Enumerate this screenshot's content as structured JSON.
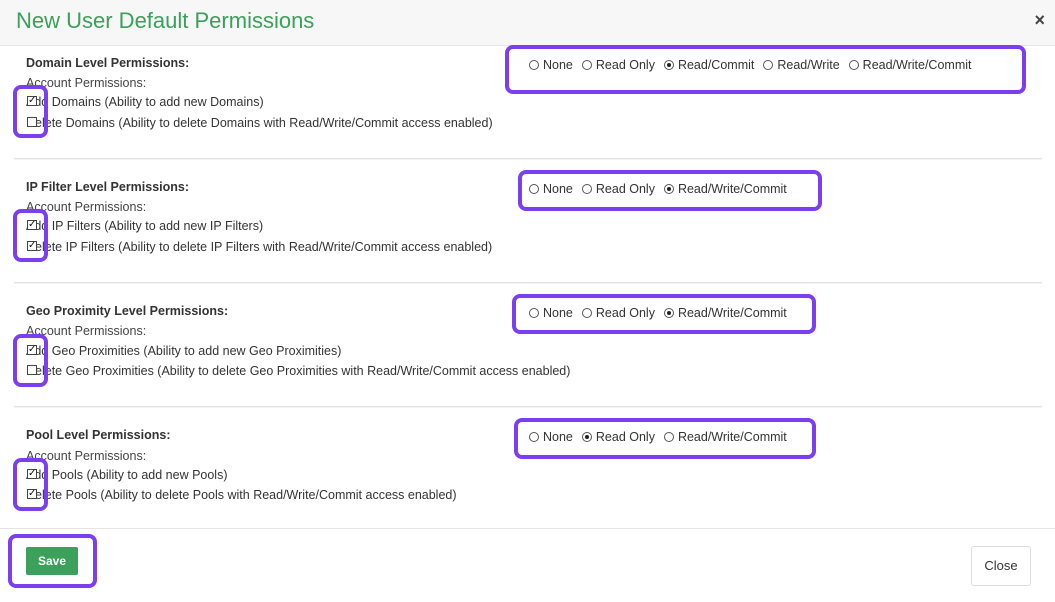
{
  "dialog": {
    "title": "New User Default Permissions",
    "close_icon": "×",
    "save_label": "Save",
    "close_label": "Close"
  },
  "sections": [
    {
      "title": "Domain Level Permissions:",
      "sub": "Account Permissions:",
      "checks": [
        {
          "label": "Add Domains (Ability to add new Domains)",
          "checked": true
        },
        {
          "label": "Delete Domains (Ability to delete Domains with Read/Write/Commit access enabled)",
          "checked": false
        }
      ],
      "radios": [
        {
          "label": "None",
          "selected": false
        },
        {
          "label": "Read Only",
          "selected": false
        },
        {
          "label": "Read/Commit",
          "selected": true
        },
        {
          "label": "Read/Write",
          "selected": false
        },
        {
          "label": "Read/Write/Commit",
          "selected": false
        }
      ]
    },
    {
      "title": "IP Filter Level Permissions:",
      "sub": "Account Permissions:",
      "checks": [
        {
          "label": "Add IP Filters (Ability to add new IP Filters)",
          "checked": true
        },
        {
          "label": "Delete IP Filters (Ability to delete IP Filters with Read/Write/Commit access enabled)",
          "checked": true
        }
      ],
      "radios": [
        {
          "label": "None",
          "selected": false
        },
        {
          "label": "Read Only",
          "selected": false
        },
        {
          "label": "Read/Write/Commit",
          "selected": true
        }
      ]
    },
    {
      "title": "Geo Proximity Level Permissions:",
      "sub": "Account Permissions:",
      "checks": [
        {
          "label": "Add Geo Proximities (Ability to add new Geo Proximities)",
          "checked": true
        },
        {
          "label": "Delete Geo Proximities (Ability to delete Geo Proximities with Read/Write/Commit access enabled)",
          "checked": false
        }
      ],
      "radios": [
        {
          "label": "None",
          "selected": false
        },
        {
          "label": "Read Only",
          "selected": false
        },
        {
          "label": "Read/Write/Commit",
          "selected": true
        }
      ]
    },
    {
      "title": "Pool Level Permissions:",
      "sub": "Account Permissions:",
      "checks": [
        {
          "label": "Add Pools (Ability to add new Pools)",
          "checked": true
        },
        {
          "label": "Delete Pools (Ability to delete Pools with Read/Write/Commit access enabled)",
          "checked": true
        }
      ],
      "radios": [
        {
          "label": "None",
          "selected": false
        },
        {
          "label": "Read Only",
          "selected": true
        },
        {
          "label": "Read/Write/Commit",
          "selected": false
        }
      ]
    }
  ],
  "colors": {
    "title": "#3aa05a",
    "save_button": "#3aa05a",
    "highlight": "#7b3ff0"
  }
}
